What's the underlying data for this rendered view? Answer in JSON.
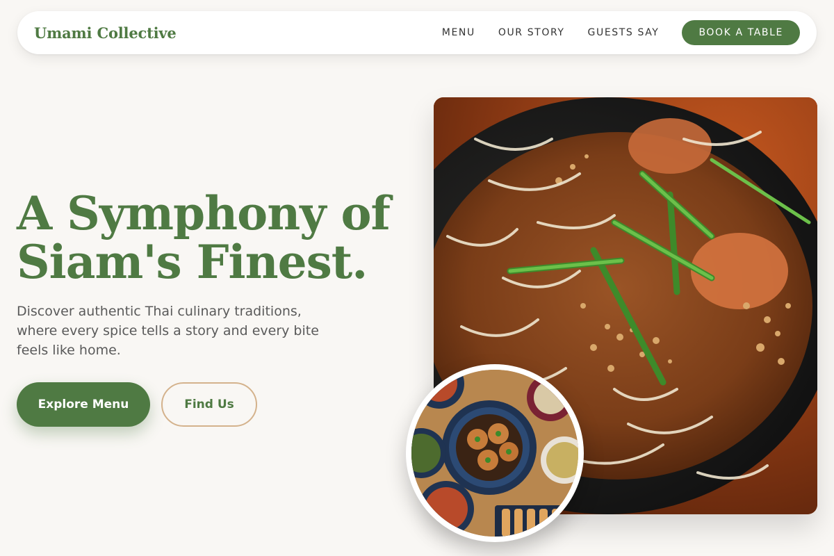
{
  "brand": {
    "name": "Umami Collective"
  },
  "nav": {
    "links": [
      "MENU",
      "OUR STORY",
      "GUESTS SAY"
    ],
    "cta": "BOOK A TABLE"
  },
  "hero": {
    "headline_line1": "A Symphony of",
    "headline_line2": "Siam's Finest.",
    "subtext": "Discover authentic Thai culinary traditions, where every spice tells a story and every bite feels like home.",
    "primary_button": "Explore Menu",
    "secondary_button": "Find Us"
  },
  "images": {
    "main": "pad-thai-noodles-photo",
    "secondary": "thai-dishes-table-photo"
  },
  "colors": {
    "brand_green": "#4f7a43",
    "outline_tan": "#d4b28c",
    "background": "#f9f7f4",
    "text_gray": "#5a5a5a"
  }
}
